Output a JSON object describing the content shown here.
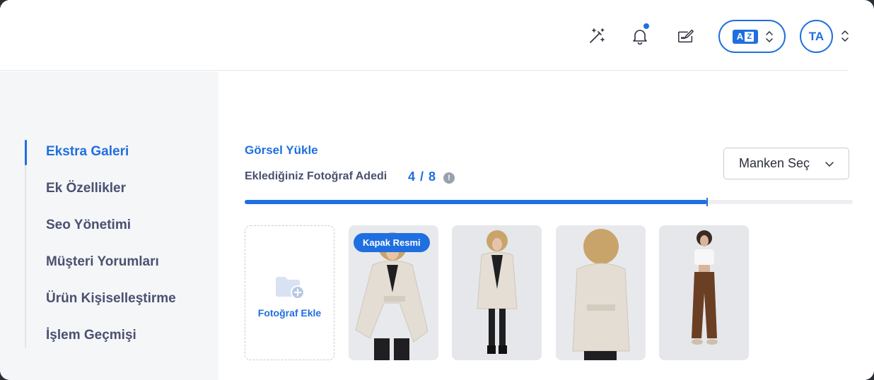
{
  "header": {
    "icons": [
      "magic-wand-icon",
      "bell-icon",
      "edit-card-icon"
    ],
    "language_switch": {
      "icon": "translate-icon",
      "letters": [
        "A",
        "Z"
      ]
    },
    "avatar_initials": "TA"
  },
  "sidebar": {
    "items": [
      {
        "label": "Ekstra Galeri",
        "active": true
      },
      {
        "label": "Ek Özellikler",
        "active": false
      },
      {
        "label": "Seo Yönetimi",
        "active": false
      },
      {
        "label": "Müşteri Yorumları",
        "active": false
      },
      {
        "label": "Ürün Kişiselleştirme",
        "active": false
      },
      {
        "label": "İşlem Geçmişi",
        "active": false
      }
    ]
  },
  "main": {
    "title": "Görsel Yükle",
    "count_label": "Eklediğiniz Fotoğraf Adedi",
    "count_value": "4 / 8",
    "progress": 0.76,
    "info_icon": "!",
    "manken_select": "Manken Seç",
    "add_photo_label": "Fotoğraf Ekle",
    "cover_badge": "Kapak Resmi",
    "photos": [
      "coat-front-belt",
      "coat-front-open",
      "coat-back",
      "white-top-brown-pants"
    ]
  },
  "colors": {
    "accent": "#1f6fe0",
    "text": "#4a5170",
    "sidebar_bg": "#f5f6f8"
  }
}
